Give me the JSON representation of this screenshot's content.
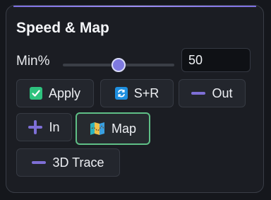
{
  "panel": {
    "title": "Speed & Map"
  },
  "min_control": {
    "label": "Min%",
    "value": "50",
    "slider_fraction": 0.5
  },
  "buttons": [
    {
      "id": "apply",
      "label": "Apply",
      "icon": "check-box-icon",
      "icon_color": "#2ec27e",
      "active": false
    },
    {
      "id": "sr",
      "label": "S+R",
      "icon": "sync-icon",
      "icon_color": "#1e8fe0",
      "active": false
    },
    {
      "id": "out",
      "label": "Out",
      "icon": "minus-icon",
      "icon_color": "#7e6fd6",
      "active": false
    },
    {
      "id": "in",
      "label": "In",
      "icon": "plus-icon",
      "icon_color": "#7e6fd6",
      "active": false
    },
    {
      "id": "map",
      "label": "Map",
      "icon": "map-icon",
      "icon_color": "#2bb3c0",
      "active": true
    },
    {
      "id": "trace",
      "label": "3D Trace",
      "icon": "minus-icon",
      "icon_color": "#7e6fd6",
      "active": false
    }
  ],
  "colors": {
    "accent": "#7e79df",
    "active_border": "#5fbf86",
    "panel_bg": "#1b1d23"
  }
}
